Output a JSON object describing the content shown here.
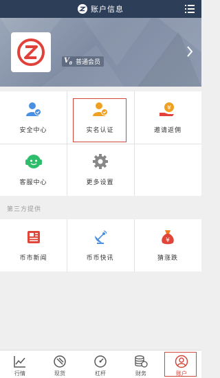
{
  "header": {
    "title": "账户信息",
    "logo_icon": "zb-logo-icon",
    "menu_icon": "menu-icon"
  },
  "profile": {
    "member_level_badge": "V",
    "member_level_sub": "0",
    "member_label": "普通会员"
  },
  "grid_main": [
    {
      "label": "安全中心",
      "icon": "security-user-icon",
      "color": "#4a90e2"
    },
    {
      "label": "实名认证",
      "icon": "verified-user-icon",
      "color": "#f0a020"
    },
    {
      "label": "邀请返佣",
      "icon": "invite-commission-icon",
      "color": "#f08a20"
    },
    {
      "label": "客服中心",
      "icon": "customer-service-icon",
      "color": "#2ebd6b"
    },
    {
      "label": "更多设置",
      "icon": "gear-icon",
      "color": "#888888"
    }
  ],
  "third_party": {
    "section_title": "第三方提供",
    "items": [
      {
        "label": "币市新闻",
        "icon": "newspaper-icon",
        "color": "#e0453a"
      },
      {
        "label": "币币快讯",
        "icon": "satellite-dish-icon",
        "color": "#4a90e2"
      },
      {
        "label": "猜涨跌",
        "icon": "money-bag-icon",
        "color": "#f07a20"
      }
    ]
  },
  "tabbar": [
    {
      "label": "行情",
      "icon": "chart-line-icon"
    },
    {
      "label": "现货",
      "icon": "spot-icon"
    },
    {
      "label": "杠杆",
      "icon": "gauge-icon"
    },
    {
      "label": "财务",
      "icon": "coins-icon"
    },
    {
      "label": "账户",
      "icon": "user-icon",
      "active": true
    }
  ],
  "colors": {
    "header_bg": "#2d3e59",
    "accent_red": "#d0463b"
  }
}
